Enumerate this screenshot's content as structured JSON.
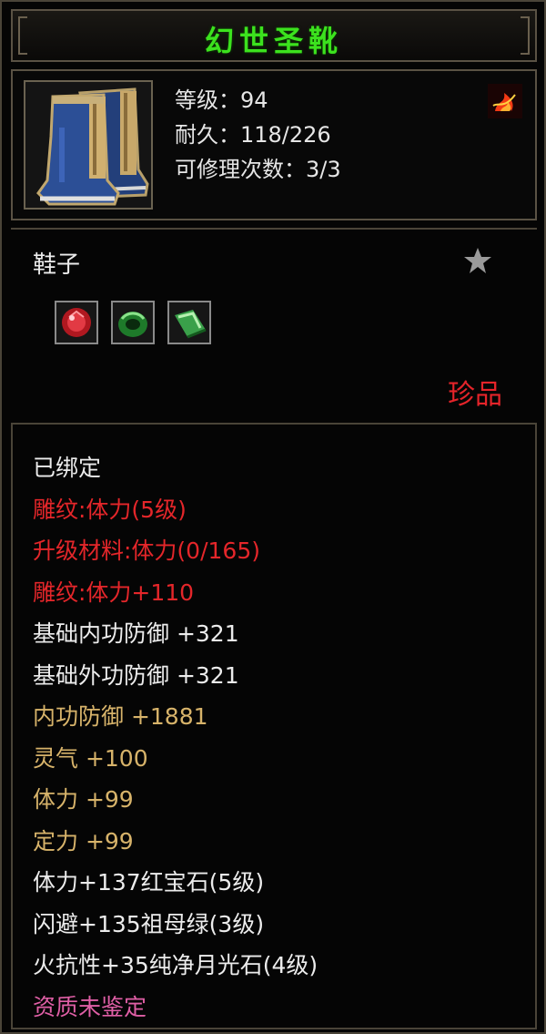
{
  "item": {
    "name": "幻世圣靴",
    "level_text": "等级：94",
    "durability_text": "耐久：118/226",
    "repairs_text": "可修理次数：3/3",
    "category": "鞋子",
    "rarity": "珍品",
    "sockets": [
      "red-gem-icon",
      "green-ring-gem-icon",
      "green-jade-icon"
    ]
  },
  "attributes": [
    {
      "text": "已绑定",
      "color": "white"
    },
    {
      "text": "雕纹:体力(5级)",
      "color": "red"
    },
    {
      "text": "升级材料:体力(0/165)",
      "color": "red"
    },
    {
      "text": "雕纹:体力+110",
      "color": "red"
    },
    {
      "text": "基础内功防御 +321",
      "color": "white"
    },
    {
      "text": "基础外功防御 +321",
      "color": "white"
    },
    {
      "text": "内功防御 +1881",
      "color": "gold"
    },
    {
      "text": "灵气 +100",
      "color": "gold"
    },
    {
      "text": "体力 +99",
      "color": "gold"
    },
    {
      "text": "定力 +99",
      "color": "gold"
    },
    {
      "text": "体力+137红宝石(5级)",
      "color": "white"
    },
    {
      "text": "闪避+135祖母绿(3级)",
      "color": "white"
    },
    {
      "text": "火抗性+35纯净月光石(4级)",
      "color": "white"
    },
    {
      "text": "资质未鉴定",
      "color": "pink"
    }
  ],
  "colors": {
    "title": "#3ce21e",
    "red": "#e4262a",
    "gold": "#d7b36a",
    "pink": "#e05fa6"
  }
}
